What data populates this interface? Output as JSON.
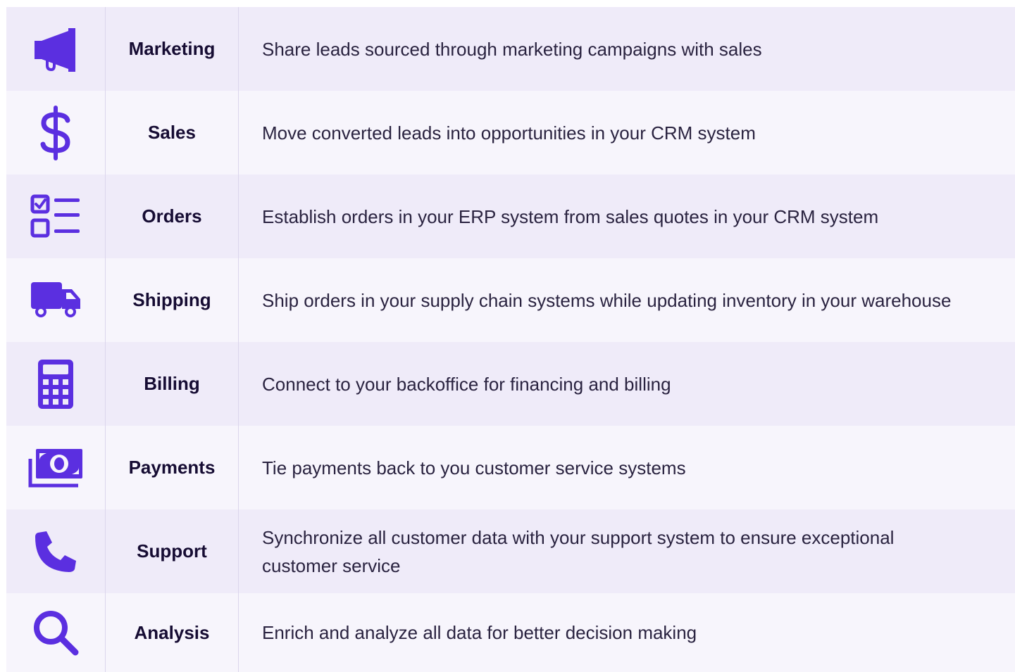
{
  "accent_color": "#5b2fe0",
  "rows": [
    {
      "icon": "megaphone-icon",
      "label": "Marketing",
      "description": "Share leads sourced through marketing campaigns with sales"
    },
    {
      "icon": "dollar-sign-icon",
      "label": "Sales",
      "description": "Move converted leads into opportunities in your CRM system"
    },
    {
      "icon": "checklist-icon",
      "label": "Orders",
      "description": "Establish orders in your ERP system from sales quotes in your CRM system"
    },
    {
      "icon": "truck-icon",
      "label": "Shipping",
      "description": "Ship orders in your supply chain systems while updating inventory in your warehouse"
    },
    {
      "icon": "calculator-icon",
      "label": "Billing",
      "description": "Connect to your backoffice for financing and billing"
    },
    {
      "icon": "money-bill-icon",
      "label": "Payments",
      "description": "Tie payments back to you customer service systems"
    },
    {
      "icon": "phone-icon",
      "label": "Support",
      "description": "Synchronize all customer data with your support system to ensure exceptional customer service"
    },
    {
      "icon": "search-icon",
      "label": "Analysis",
      "description": "Enrich and analyze all data for better decision making"
    }
  ]
}
